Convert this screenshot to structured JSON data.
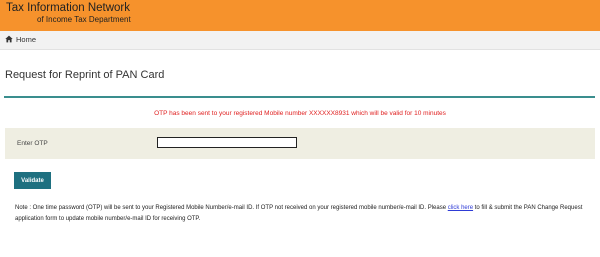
{
  "header": {
    "title": "Tax Information Network",
    "subtitle": "of Income Tax Department"
  },
  "nav": {
    "home_label": "Home",
    "home_icon": "home-icon"
  },
  "page": {
    "title": "Request for Reprint of PAN Card"
  },
  "message": {
    "otp_sent": "OTP has been sent to your registered Mobile number XXXXXX8931 which will be valid for 10 minutes",
    "color": "#e02020"
  },
  "form": {
    "otp_label": "Enter OTP",
    "otp_value": "",
    "validate_label": "Validate"
  },
  "note": {
    "text_before_link": "Note : One time password (OTP) will be sent to your Registered Mobile Number/e-mail ID. If OTP not received on your registered mobile number/e-mail ID. Please ",
    "link_text": "click here",
    "text_after_link": " to fill & submit the PAN Change Request application form to update mobile number/e-mail ID for receiving OTP."
  },
  "colors": {
    "header_bg": "#f6922c",
    "accent": "#3a8e8e",
    "button_bg": "#1e7080",
    "panel_bg": "#efeee2",
    "link": "#2e3bd6"
  }
}
